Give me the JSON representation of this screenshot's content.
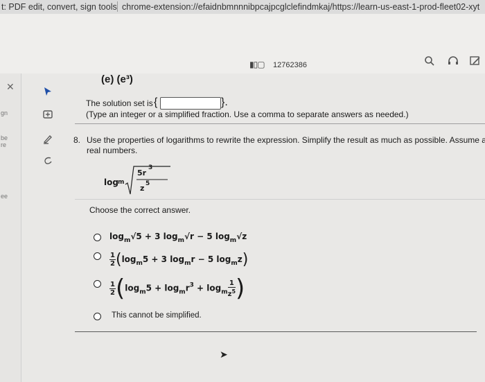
{
  "browser": {
    "tab_title": "t: PDF edit, convert, sign tools",
    "address": "chrome-extension://efaidnbmnnnibpcajpcglclefindmkaj/https://learn-us-east-1-prod-fleet02-xyt"
  },
  "toolbar": {
    "doc_id": "12762386",
    "icons": [
      "page-icon",
      "search-icon",
      "read-aloud-icon",
      "edit-icon"
    ]
  },
  "left_edge": {
    "fragments": [
      "gn",
      "be",
      "re",
      "ee"
    ]
  },
  "sidebar": {
    "icons": [
      "close-icon",
      "select-arrow-icon",
      "add-comment-icon",
      "highlight-icon",
      "draw-icon"
    ]
  },
  "prev_question": {
    "choice_text": "(e)  (e³)",
    "solution_label": "The solution set is",
    "solution_brace_open": "{",
    "solution_brace_close": "}.",
    "instruction": "(Type an integer or a simplified fraction. Use a comma to separate answers as needed.)"
  },
  "question8": {
    "number": "8.",
    "line1": "Use the properties of logarithms to rewrite the expression. Simplify the result as much as possible. Assume al",
    "line2": "real numbers.",
    "expr_log": "log",
    "expr_base": "m",
    "expr_num_base": "5r",
    "expr_num_exp": "3",
    "expr_den_base": "z",
    "expr_den_exp": "5",
    "prompt": "Choose the correct answer.",
    "options": [
      {
        "a1": "log",
        "s1": "m",
        "r1": "√5",
        "a2": " + 3 log",
        "s2": "m",
        "r2": "√r",
        "a3": " − 5 log",
        "s3": "m",
        "r3": "√z"
      },
      {
        "fn": "1",
        "fd": "2",
        "open": "(",
        "a1": "log",
        "s1": "m",
        "b1": "5 + 3 log",
        "s2": "m",
        "b2": "r − 5 log",
        "s3": "m",
        "b3": "z",
        "close": ")"
      },
      {
        "fn": "1",
        "fd": "2",
        "open": "(",
        "a1": "log",
        "s1": "m",
        "b1": "5 + log",
        "s2": "m",
        "b2": "r",
        "e2": "3",
        "b3": " + log",
        "s3": "m",
        "in": "1",
        "id": "z",
        "ie": "5",
        "close": ")"
      },
      {
        "text": "This cannot be simplified."
      }
    ]
  }
}
